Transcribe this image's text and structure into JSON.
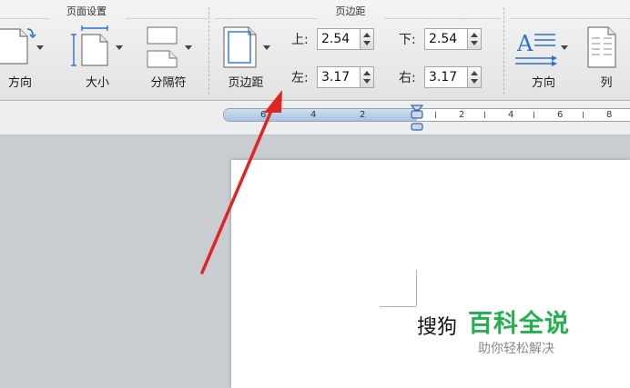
{
  "colors": {
    "arrow": "#e02424",
    "watermark_green": "#23b14d",
    "ruler_margin": "#a7c2e2"
  },
  "ribbon": {
    "page_setup_group": {
      "title": "页面设置",
      "orientation_label": "方向",
      "size_label": "大小",
      "breaks_label": "分隔符"
    },
    "margins_group": {
      "title": "页边距",
      "margins_button_label": "页边距",
      "top_label": "上:",
      "top_value": "2.54",
      "bottom_label": "下:",
      "bottom_value": "2.54",
      "left_label": "左:",
      "left_value": "3.17",
      "right_label": "右:",
      "right_value": "3.17"
    },
    "text_group": {
      "direction_label": "方向",
      "columns_label": "列"
    }
  },
  "ruler": {
    "labels": [
      "6",
      "4",
      "2",
      "2",
      "4",
      "6",
      "8"
    ]
  },
  "document": {
    "text": "搜狗"
  },
  "watermark": {
    "title": "百科全说",
    "subtitle": "助你轻松解决"
  }
}
